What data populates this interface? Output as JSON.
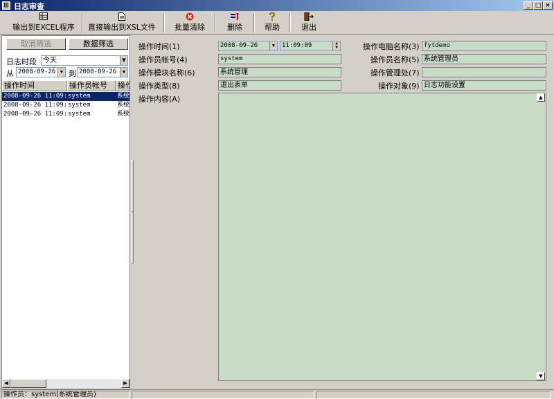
{
  "window": {
    "title": "日志审查",
    "minimize": "_",
    "maximize": "□",
    "close": "×"
  },
  "toolbar": {
    "export_excel": "输出到EXCEL程序",
    "export_xml": "直接输出到XSL文件",
    "batch_clear": "批量清除",
    "delete": "删除",
    "help": "帮助",
    "exit": "退出"
  },
  "icons": {
    "export_excel": "table-icon",
    "export_xml": "document-icon",
    "batch_clear": "red-x-icon",
    "delete": "delete-icon",
    "help": "help-icon",
    "exit": "exit-door-icon"
  },
  "filter": {
    "cancel_label": "取消筛选",
    "filter_label": "数据筛选",
    "period_label": "日志时段",
    "period_value": "今天",
    "from_label": "从",
    "from_date": "2008-09-26",
    "to_label": "到",
    "to_date": "2008-09-26"
  },
  "grid": {
    "columns": [
      "操作时间",
      "操作员帐号",
      "操作"
    ],
    "rows": [
      [
        "2008-09-26 11:09:",
        "system",
        "系统"
      ],
      [
        "2008-09-26 11:09:",
        "system",
        "系统"
      ],
      [
        "2008-09-26 11:09:",
        "system",
        "系统"
      ]
    ]
  },
  "detail": {
    "time_label": "操作时间(1)",
    "date_value": "2008-09-26",
    "time_value": "11:09:09",
    "computer_label": "操作电脑名称(3)",
    "computer_value": "fytdemo",
    "account_label": "操作员帐号(4)",
    "account_value": "system",
    "operator_name_label": "操作员名称(5)",
    "operator_name_value": "系统管理员",
    "module_label": "操作模块名称(6)",
    "module_value": "系统管理",
    "manager_label": "操作管理处(7)",
    "manager_value": "",
    "type_label": "操作类型(8)",
    "type_value": "退出表单",
    "object_label": "操作对象(9)",
    "object_value": "日志功能设置",
    "content_label": "操作内容(A)",
    "content_value": ""
  },
  "status": {
    "operator": "操作员：system(系统管理员)"
  }
}
